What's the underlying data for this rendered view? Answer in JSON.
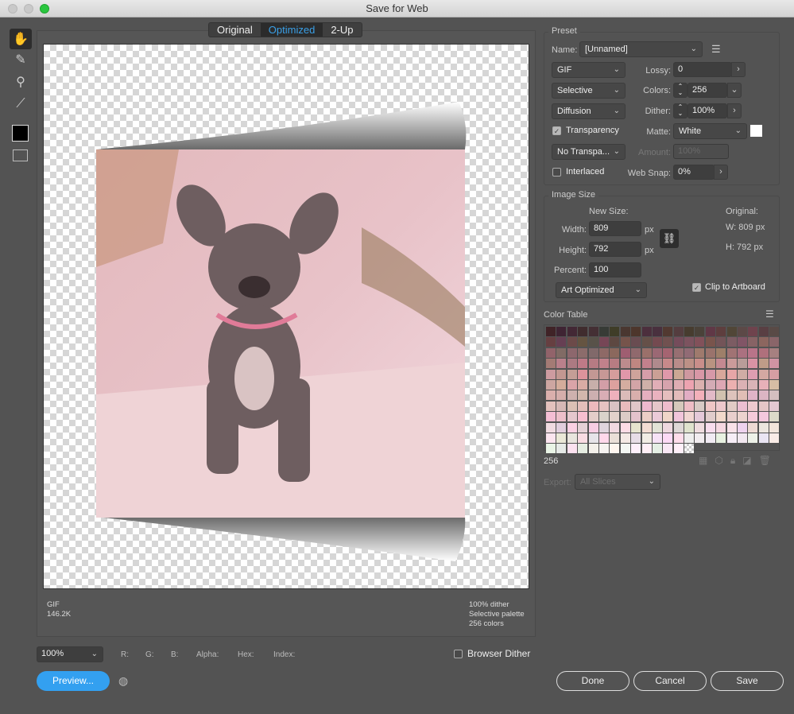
{
  "window": {
    "title": "Save for Web"
  },
  "tools": [
    "hand-icon",
    "slice-select-icon",
    "zoom-icon",
    "eyedropper-icon",
    "eyedropper-color-swatch",
    "toggle-slices-icon"
  ],
  "view_tabs": [
    {
      "label": "Original"
    },
    {
      "label": "Optimized",
      "active": true
    },
    {
      "label": "2-Up"
    }
  ],
  "preview_info": {
    "format": "GIF",
    "size": "146.2K",
    "dither": "100% dither",
    "palette": "Selective palette",
    "colors": "256 colors"
  },
  "status": {
    "zoom": "100%",
    "r": "R:",
    "g": "G:",
    "b": "B:",
    "alpha": "Alpha:",
    "hex": "Hex:",
    "index": "Index:",
    "browser_dither": "Browser Dither",
    "browser_dither_checked": false
  },
  "preview_button": "Preview...",
  "preset": {
    "legend": "Preset",
    "name_label": "Name:",
    "name": "[Unnamed]",
    "format": "GIF",
    "reduction": "Selective",
    "dither_algo": "Diffusion",
    "lossy_label": "Lossy:",
    "lossy": "0",
    "colors_label": "Colors:",
    "colors": "256",
    "dither_label": "Dither:",
    "dither": "100%",
    "transparency": "Transparency",
    "transparency_checked": true,
    "matte_label": "Matte:",
    "matte": "White",
    "matte_color": "#ffffff",
    "trans_dither": "No Transpa...",
    "amount_label": "Amount:",
    "amount": "100%",
    "interlaced": "Interlaced",
    "interlaced_checked": false,
    "websnap_label": "Web Snap:",
    "websnap": "0%"
  },
  "image_size": {
    "legend": "Image Size",
    "new_size": "New Size:",
    "width_label": "Width:",
    "width": "809",
    "height_label": "Height:",
    "height": "792",
    "percent_label": "Percent:",
    "percent": "100",
    "unit": "px",
    "original": "Original:",
    "orig_w": "W:  809 px",
    "orig_h": "H:  792 px",
    "quality": "Art Optimized",
    "clip": "Clip to Artboard",
    "clip_checked": true
  },
  "color_table": {
    "title": "Color Table",
    "count": "256",
    "dark": "#3f2a2c",
    "mid": "#d39a9c",
    "light": "#f7f3f5"
  },
  "export": {
    "label": "Export:",
    "value": "All Slices"
  },
  "buttons": {
    "done": "Done",
    "cancel": "Cancel",
    "save": "Save"
  },
  "accent": "#33a0f0"
}
